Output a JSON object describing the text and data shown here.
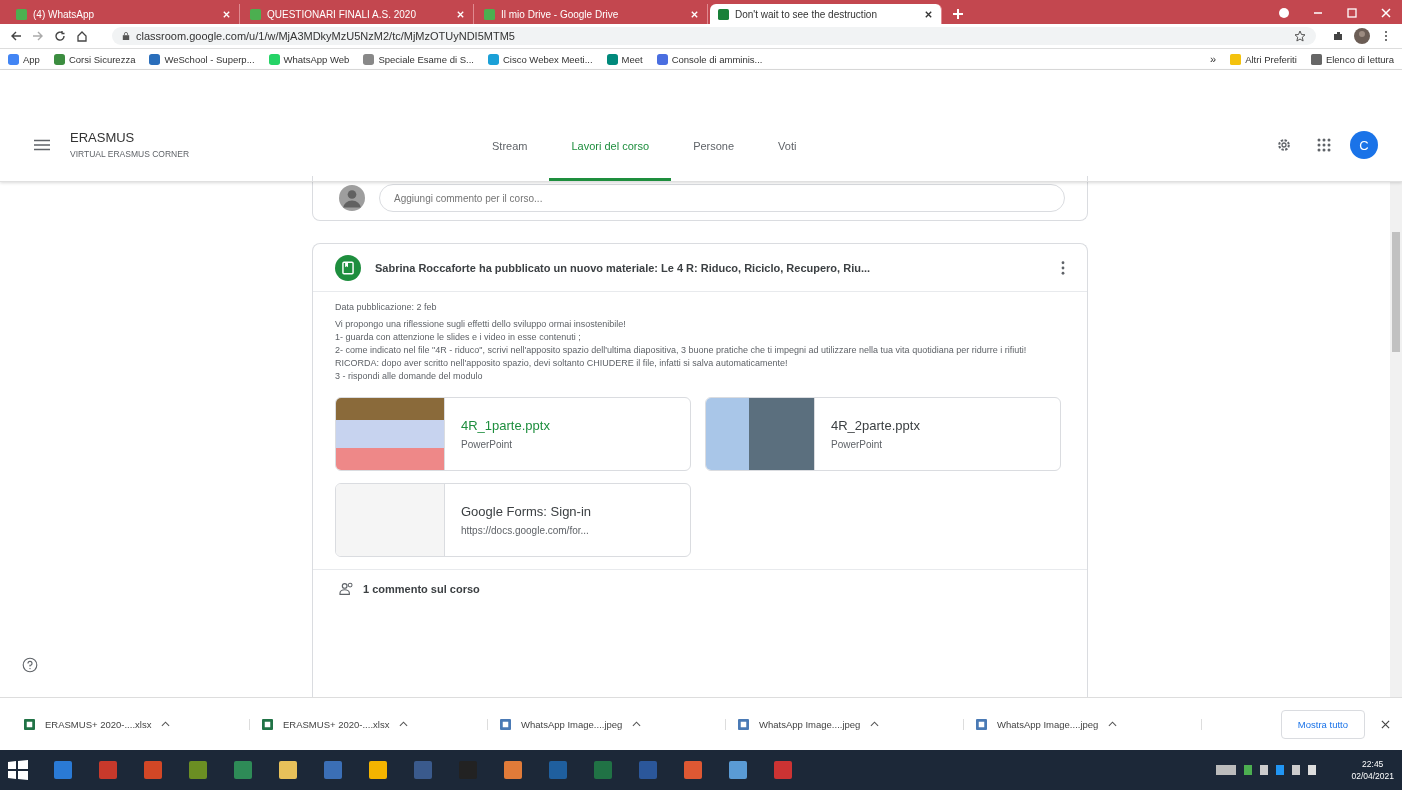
{
  "browser": {
    "tabs": [
      {
        "title": "(4) WhatsApp",
        "selected": false
      },
      {
        "title": "QUESTIONARI FINALI A.S. 2020",
        "selected": false
      },
      {
        "title": "Il mio Drive - Google Drive",
        "selected": false
      },
      {
        "title": "Don't wait to see the destruction",
        "selected": true
      }
    ],
    "url": "classroom.google.com/u/1/w/MjA3MDkyMzU5NzM2/tc/MjMzOTUyNDI5MTM5",
    "bookmarks": [
      "App",
      "Corsi Sicurezza",
      "WeSchool - Superp...",
      "WhatsApp Web",
      "Speciale Esame di S...",
      "Cisco Webex Meeti...",
      "Meet",
      "Console di amminis..."
    ],
    "bookmarks_overflow": "»",
    "bookmarks_right": [
      "Altri Preferiti",
      "Elenco di lettura"
    ]
  },
  "header": {
    "course": "ERASMUS",
    "section": "VIRTUAL ERASMUS CORNER",
    "nav": [
      {
        "label": "Stream",
        "selected": false
      },
      {
        "label": "Lavori del corso",
        "selected": true
      },
      {
        "label": "Persone",
        "selected": false
      },
      {
        "label": "Voti",
        "selected": false
      }
    ],
    "avatar": "C"
  },
  "comment_box": {
    "placeholder": "Aggiungi commento per il corso..."
  },
  "post": {
    "title": "Sabrina Roccaforte ha pubblicato un nuovo materiale: Le 4 R: Riduco, Riciclo, Recupero, Riu...",
    "date": "Data pubblicazione: 2 feb",
    "description": "Vi propongo una riflessione sugli effetti dello sviluppo ormai insostenibile!\n1- guarda con attenzione le slides e i video in esse contenuti ;\n2- come indicato nel file \"4R - riduco\", scrivi nell'apposito spazio dell'ultima diapositiva, 3 buone pratiche che ti impegni ad utilizzare nella tua vita quotidiana per ridurre i rifiuti! RICORDA: dopo aver scritto nell'apposito spazio, devi soltanto CHIUDERE il file, infatti si salva automaticamente!\n3 - rispondi alle domande del modulo",
    "attachments": [
      {
        "title": "4R_1parte.pptx",
        "subtitle": "PowerPoint",
        "highlighted": true
      },
      {
        "title": "4R_2parte.pptx",
        "subtitle": "PowerPoint",
        "highlighted": false
      },
      {
        "title": "Google Forms: Sign-in",
        "subtitle": "https://docs.google.com/for...",
        "highlighted": false
      }
    ],
    "comments": "1 commento sul corso"
  },
  "downloads": {
    "items": [
      "ERASMUS+ 2020-....xlsx",
      "ERASMUS+ 2020-....xlsx",
      "WhatsApp Image....jpeg",
      "WhatsApp Image....jpeg",
      "WhatsApp Image....jpeg"
    ],
    "show_all": "Mostra tutto"
  },
  "taskbar": {
    "time": "22:45",
    "date": "02/04/2021"
  }
}
